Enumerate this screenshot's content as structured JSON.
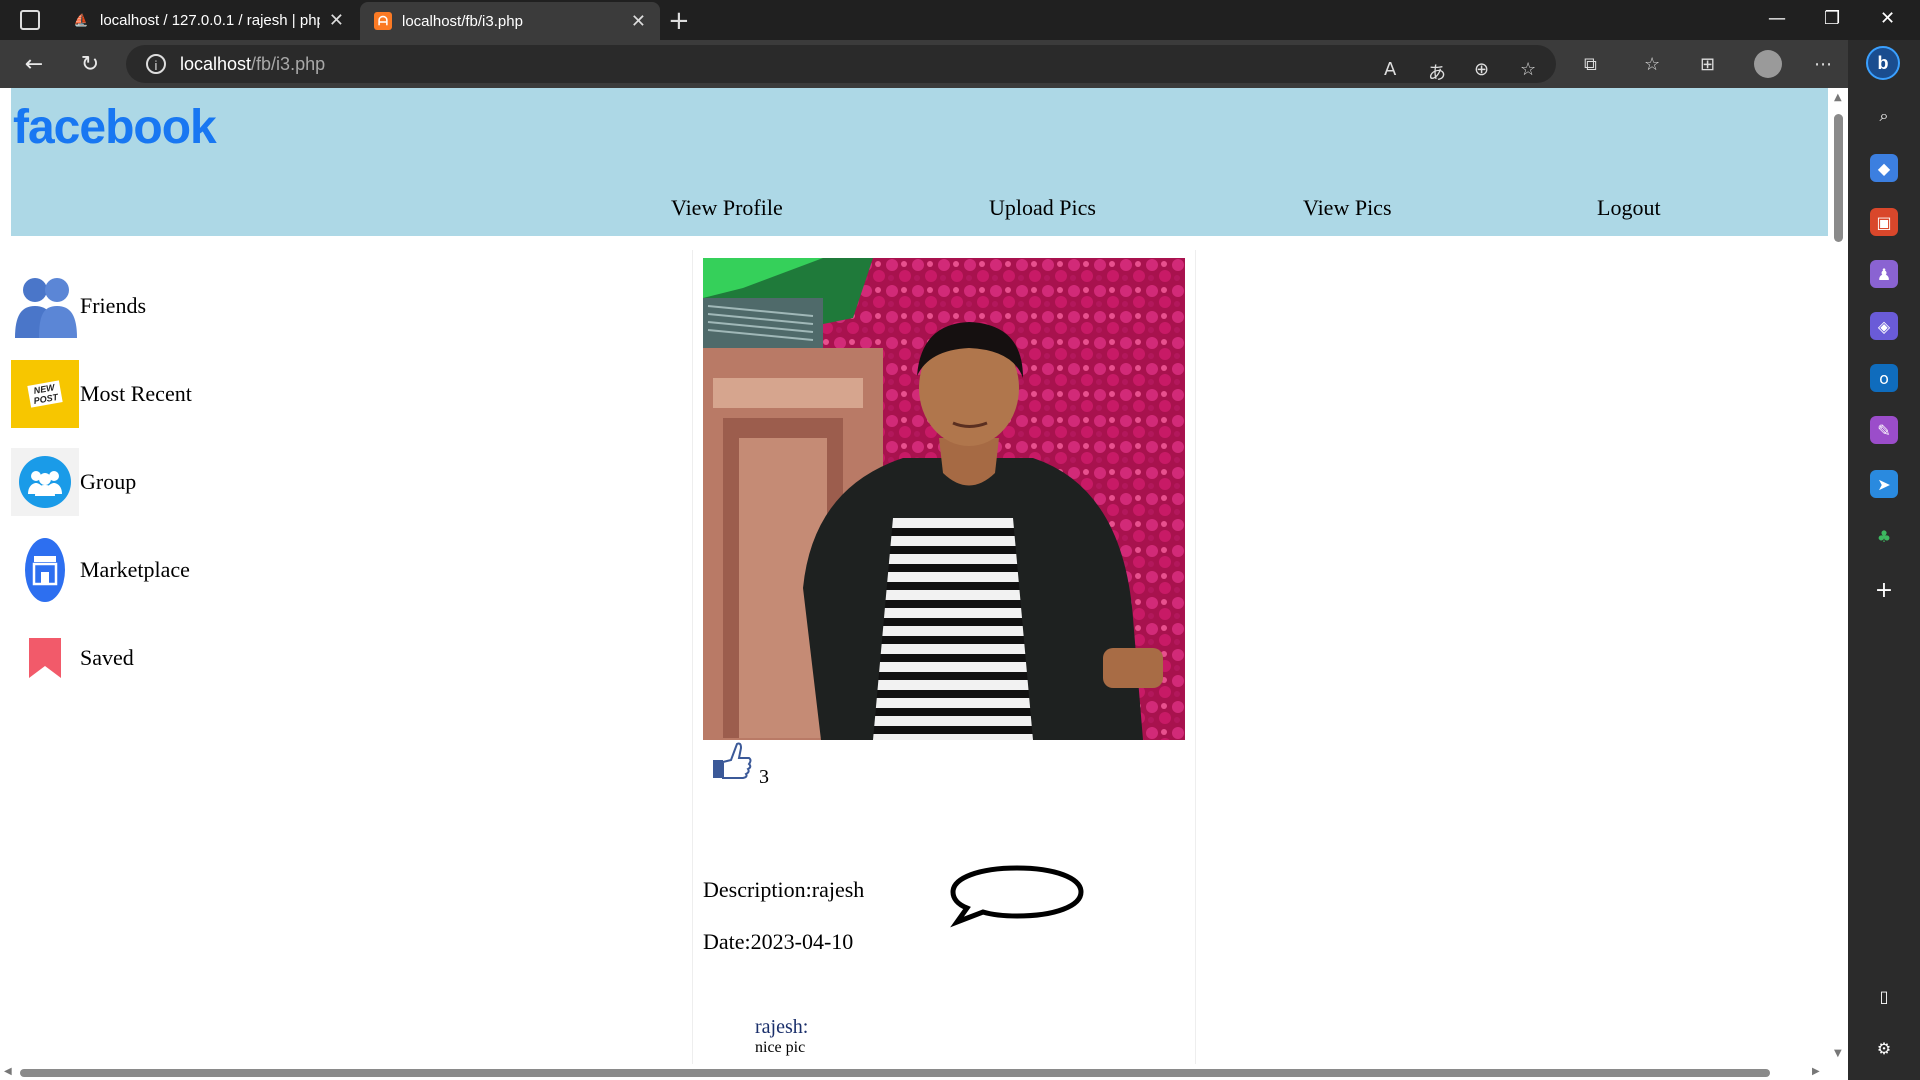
{
  "browser": {
    "tabs": [
      {
        "title": "localhost / 127.0.0.1 / rajesh | php",
        "favicon": "phpmyadmin-icon"
      },
      {
        "title": "localhost/fb/i3.php",
        "favicon": "xampp-icon"
      }
    ],
    "url_host": "localhost",
    "url_path": "/fb/i3.php"
  },
  "header": {
    "logo": "facebook",
    "menu": [
      "View Profile",
      "Upload Pics",
      "View Pics",
      "Logout"
    ]
  },
  "sidebar": {
    "items": [
      {
        "label": "Friends",
        "icon": "friends-icon"
      },
      {
        "label": "Most Recent",
        "icon": "new-post-icon",
        "icon_text": "NEW POST"
      },
      {
        "label": "Group",
        "icon": "group-icon"
      },
      {
        "label": "Marketplace",
        "icon": "marketplace-icon"
      },
      {
        "label": "Saved",
        "icon": "bookmark-icon"
      }
    ]
  },
  "post": {
    "likes": "3",
    "description": "Description:rajesh",
    "date": "Date:2023-04-10",
    "comment_user": "rajesh:",
    "comment_text": "nice pic"
  },
  "colors": {
    "header_bg": "#add8e6",
    "logo": "#1877f2"
  }
}
